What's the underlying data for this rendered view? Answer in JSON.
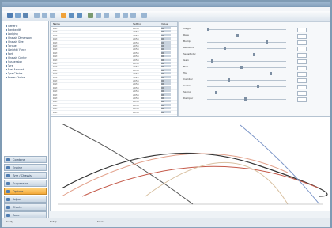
{
  "left": {
    "tree": [
      "Generic",
      "Bandwidth",
      "Lodging",
      "Chassis Dimension",
      "Chassis Size",
      "Torque",
      "Weight / Force",
      "Fork",
      "Chassis Center",
      "Suspension",
      "Tyre",
      "Fuel Amount",
      "Tyre Choice",
      "Power Choice"
    ],
    "nav": [
      {
        "label": "Combine"
      },
      {
        "label": "Engine"
      },
      {
        "label": "Tyre / Chassis"
      },
      {
        "label": "Suspension"
      },
      {
        "label": "Options",
        "active": true
      },
      {
        "label": "Adjust"
      },
      {
        "label": "Charts"
      },
      {
        "label": "Race"
      }
    ]
  },
  "table": {
    "headers": [
      "Name",
      "Setting",
      "Value"
    ],
    "rows": [
      {
        "name": "Ctrl",
        "setting": "2054",
        "value": "Ok"
      },
      {
        "name": "Ctrl",
        "setting": "2054",
        "value": "Ok"
      },
      {
        "name": "Ctrl",
        "setting": "2054",
        "value": "Ok"
      },
      {
        "name": "Ctrl",
        "setting": "2054",
        "value": "Ok"
      },
      {
        "name": "Ctrl",
        "setting": "2054",
        "value": "Ok"
      },
      {
        "name": "Ctrl",
        "setting": "2054",
        "value": "Ok"
      },
      {
        "name": "Ctrl",
        "setting": "2054",
        "value": "Ok"
      },
      {
        "name": "Ctrl",
        "setting": "2054",
        "value": "Ok"
      },
      {
        "name": "Ctrl",
        "setting": "2054",
        "value": "Ok"
      },
      {
        "name": "Ctrl",
        "setting": "2054",
        "value": "Ok"
      },
      {
        "name": "Ctrl",
        "setting": "2054",
        "value": "Ok"
      },
      {
        "name": "Ctrl",
        "setting": "2054",
        "value": "Ok"
      },
      {
        "name": "Ctrl",
        "setting": "2054",
        "value": "Ok"
      },
      {
        "name": "Ctrl",
        "setting": "2054",
        "value": "Ok"
      },
      {
        "name": "Ctrl",
        "setting": "2054",
        "value": "Ok"
      },
      {
        "name": "Ctrl",
        "setting": "2054",
        "value": "Ok"
      },
      {
        "name": "Ctrl",
        "setting": "2054",
        "value": "Ok"
      },
      {
        "name": "Ctrl",
        "setting": "2054",
        "value": "Ok"
      },
      {
        "name": "Ctrl",
        "setting": "2054",
        "value": "Ok"
      },
      {
        "name": "Ctrl",
        "setting": "2054",
        "value": "Ok"
      },
      {
        "name": "Ctrl",
        "setting": "2054",
        "value": "Ok"
      },
      {
        "name": "Ctrl",
        "setting": "2054",
        "value": "Ok"
      },
      {
        "name": "Ctrl",
        "setting": "2054",
        "value": "Ok"
      },
      {
        "name": "Ctrl",
        "setting": "2054",
        "value": "Ok"
      },
      {
        "name": "Ctrl",
        "setting": "2054",
        "value": "Ok"
      }
    ]
  },
  "props": {
    "items": [
      "Height",
      "Rate",
      "Bump",
      "Rebound",
      "Sensitivity",
      "Gain",
      "Bias",
      "Toe",
      "Camber",
      "Caster",
      "Spring",
      "Damper"
    ]
  },
  "status": {
    "items": [
      "Ready",
      "Setup",
      "Saved"
    ]
  },
  "colors": {
    "active": "#f3a93a",
    "accent": "#4f7db2"
  }
}
